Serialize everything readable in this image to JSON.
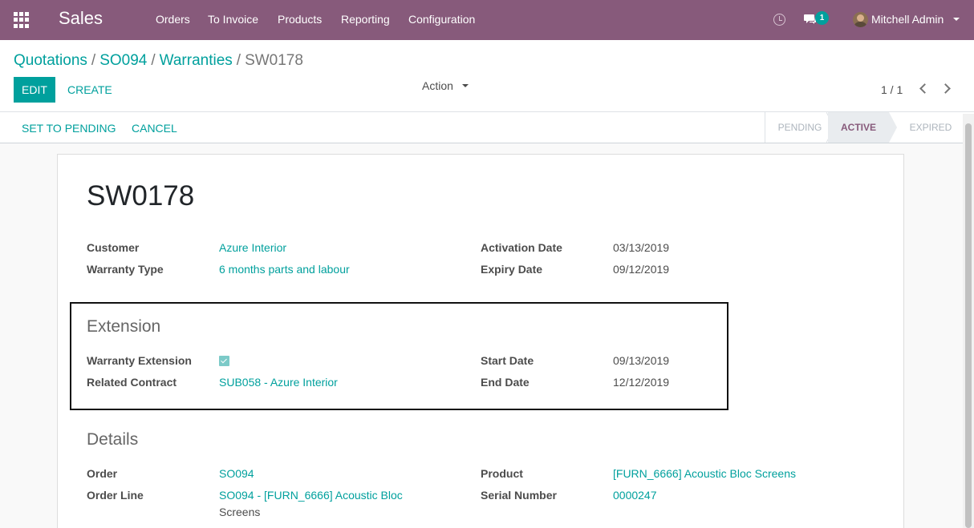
{
  "navbar": {
    "brand": "Sales",
    "menu": [
      "Orders",
      "To Invoice",
      "Products",
      "Reporting",
      "Configuration"
    ],
    "chat_count": "1",
    "user": "Mitchell Admin"
  },
  "breadcrumb": {
    "items": [
      "Quotations",
      "SO094",
      "Warranties"
    ],
    "current": "SW0178"
  },
  "toolbar": {
    "edit_label": "EDIT",
    "create_label": "CREATE",
    "action_label": "Action",
    "pager": "1 / 1"
  },
  "statusbar": {
    "set_to_pending": "SET TO PENDING",
    "cancel": "CANCEL",
    "stages": [
      "PENDING",
      "ACTIVE",
      "EXPIRED"
    ],
    "current_stage": "ACTIVE"
  },
  "form": {
    "title": "SW0178",
    "customer_label": "Customer",
    "customer_value": "Azure Interior",
    "warranty_type_label": "Warranty Type",
    "warranty_type_value": "6 months parts and labour",
    "activation_date_label": "Activation Date",
    "activation_date_value": "03/13/2019",
    "expiry_date_label": "Expiry Date",
    "expiry_date_value": "09/12/2019",
    "extension": {
      "title": "Extension",
      "warranty_extension_label": "Warranty Extension",
      "warranty_extension_checked": true,
      "related_contract_label": "Related Contract",
      "related_contract_value": "SUB058 - Azure Interior",
      "start_date_label": "Start Date",
      "start_date_value": "09/13/2019",
      "end_date_label": "End Date",
      "end_date_value": "12/12/2019"
    },
    "details": {
      "title": "Details",
      "order_label": "Order",
      "order_value": "SO094",
      "order_line_label": "Order Line",
      "order_line_value_1": "SO094 - [FURN_6666] Acoustic Bloc",
      "order_line_value_2": "Screens",
      "product_label": "Product",
      "product_value": "[FURN_6666] Acoustic Bloc Screens",
      "serial_number_label": "Serial Number",
      "serial_number_value": "0000247"
    }
  },
  "colors": {
    "navbar": "#875a7b",
    "accent": "#00a09d"
  }
}
